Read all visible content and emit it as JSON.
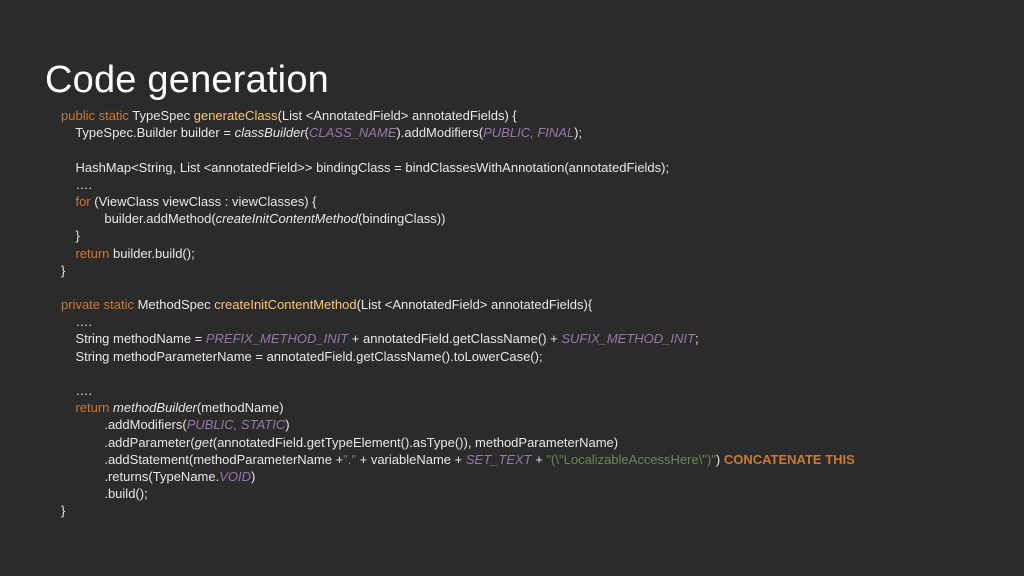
{
  "title": "Code generation",
  "code": {
    "l01": {
      "a": "public static",
      "b": " TypeSpec ",
      "c": "generateClass",
      "d": "(List <AnnotatedField> annotatedFields) {"
    },
    "l02": {
      "a": "    TypeSpec.Builder builder = ",
      "b": "classBuilder",
      "c": "(",
      "d": "CLASS_NAME",
      "e": ").addModifiers(",
      "f": "PUBLIC",
      "g": ", ",
      "h": "FINAL",
      "i": ");"
    },
    "l04": {
      "a": "    HashMap<String, List <annotatedField>> bindingClass = bindClassesWithAnnotation(annotatedFields);"
    },
    "l05": {
      "a": "    …."
    },
    "l06": {
      "a": "for",
      "b": " (ViewClass viewClass : viewClasses) {"
    },
    "l07": {
      "a": "            builder.addMethod(",
      "b": "createInitContentMethod",
      "c": "(bindingClass))"
    },
    "l08": {
      "a": "    }"
    },
    "l09": {
      "a": "return",
      "b": " builder.build();"
    },
    "l10": {
      "a": "}"
    },
    "l12": {
      "a": "private static",
      "b": " MethodSpec ",
      "c": "createInitContentMethod",
      "d": "(List <AnnotatedField> annotatedFields){"
    },
    "l13": {
      "a": "    …."
    },
    "l14": {
      "a": "    String methodName = ",
      "b": "PREFIX_METHOD_INIT",
      "c": " + annotatedField.getClassName() + ",
      "d": "SUFIX_METHOD_INIT",
      "e": ";"
    },
    "l15": {
      "a": "    String methodParameterName = annotatedField.getClassName().toLowerCase();"
    },
    "l17": {
      "a": "    …."
    },
    "l18": {
      "a": "return",
      "b": " ",
      "c": "methodBuilder",
      "d": "(methodName)"
    },
    "l19": {
      "a": "            .addModifiers(",
      "b": "PUBLIC",
      "c": ", ",
      "d": "STATIC",
      "e": ")"
    },
    "l20": {
      "a": "            .addParameter(",
      "b": "get",
      "c": "(annotatedField.getTypeElement().asType()), methodParameterName)"
    },
    "l21": {
      "a": "            .addStatement(methodParameterName +",
      "b": "\".\"",
      "c": " + variableName + ",
      "d": "SET_TEXT",
      "e": " + ",
      "f": "\"(\\\"LocalizableAccessHere\\\")\"",
      "g": ") ",
      "h": "CONCATENATE THIS"
    },
    "l22": {
      "a": "            .returns(TypeName.",
      "b": "VOID",
      "c": ")"
    },
    "l23": {
      "a": "            .build();"
    },
    "l24": {
      "a": "}"
    }
  },
  "colors": {
    "background": "#2b2b2b",
    "keyword": "#cc7832",
    "method_name": "#ffc66d",
    "constant": "#9876aa",
    "string": "#6a8759",
    "text": "#e8e8e8"
  }
}
